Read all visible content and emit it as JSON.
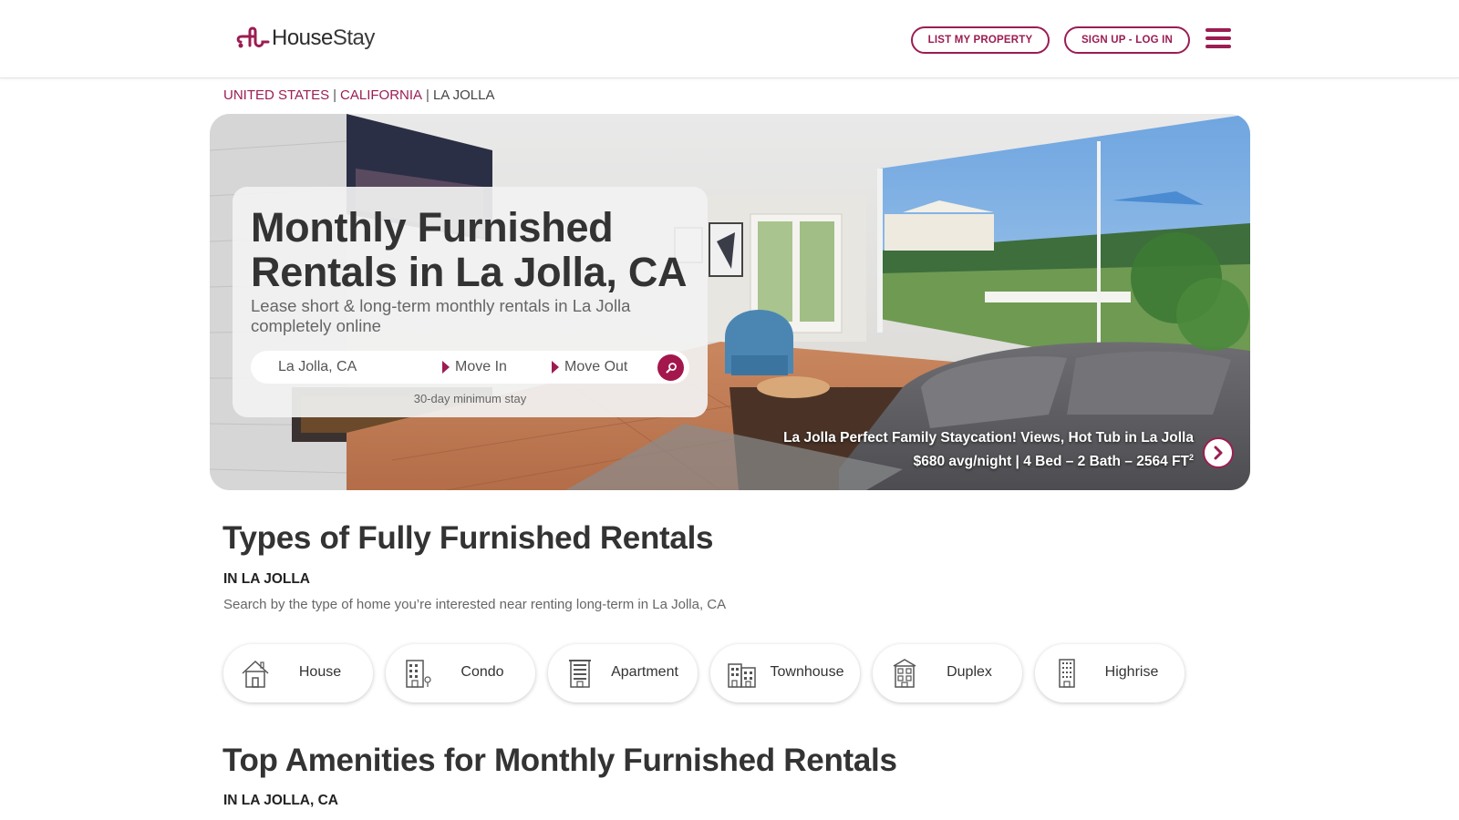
{
  "header": {
    "logo_text_house": "House",
    "logo_text_stay": "Stay",
    "list_property_label": "LIST MY PROPERTY",
    "sign_up_label": "SIGN UP - LOG IN",
    "menu_icon": "hamburger-icon",
    "brand_color": "#9b1d52"
  },
  "breadcrumb": {
    "items": [
      "UNITED STATES",
      "CALIFORNIA",
      "LA JOLLA"
    ],
    "separator": "|"
  },
  "hero": {
    "title": "Monthly Furnished Rentals in La Jolla, CA",
    "subtitle": "Lease short & long-term monthly rentals in La Jolla completely online",
    "search": {
      "location_value": "La Jolla, CA",
      "move_in_label": "Move In",
      "move_out_label": "Move Out",
      "search_icon": "search-icon"
    },
    "min_stay_note": "30-day minimum stay",
    "listing": {
      "title": "La Jolla Perfect Family Staycation! Views, Hot Tub in La Jolla",
      "meta": "$680 avg/night | 4 Bed – 2 Bath – 2564 FT",
      "meta_sup": "2"
    }
  },
  "types_section": {
    "title": "Types of Fully Furnished Rentals",
    "subheading": "IN LA JOLLA",
    "description": "Search by the type of home you’re interested near renting long-term in La Jolla, CA",
    "types": [
      {
        "label": "House",
        "icon": "house-icon"
      },
      {
        "label": "Condo",
        "icon": "condo-icon"
      },
      {
        "label": "Apartment",
        "icon": "apartment-icon"
      },
      {
        "label": "Townhouse",
        "icon": "townhouse-icon"
      },
      {
        "label": "Duplex",
        "icon": "duplex-icon"
      },
      {
        "label": "Highrise",
        "icon": "highrise-icon"
      }
    ]
  },
  "amenities_section": {
    "title": "Top Amenities for Monthly Furnished Rentals",
    "subheading": "IN LA JOLLA, CA"
  }
}
